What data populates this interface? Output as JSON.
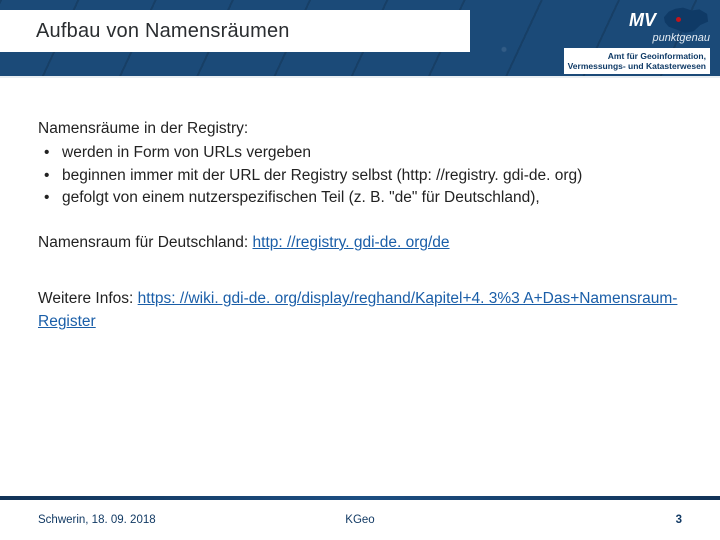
{
  "header": {
    "title": "Aufbau von Namensräumen",
    "brand_text": "MV",
    "brand_tagline": "punktgenau",
    "agency": "Amt für Geoinformation,\nVermessungs- und Katasterwesen"
  },
  "body": {
    "intro": "Namensräume in der Registry:",
    "bullets": [
      "werden in Form von URLs vergeben",
      "beginnen immer mit der URL der Registry selbst (http: //registry. gdi-de. org)",
      "gefolgt von einem nutzerspezifischen Teil (z. B. \"de\" für Deutschland),"
    ],
    "ns_label": "Namensraum für Deutschland:  ",
    "ns_link": "http: //registry. gdi-de. org/de",
    "info_label": "Weitere Infos:  ",
    "info_link": "https: //wiki. gdi-de. org/display/reghand/Kapitel+4. 3%3 A+Das+Namensraum-Register"
  },
  "footer": {
    "left": "Schwerin, 18. 09. 2018",
    "center": "KGeo",
    "page_number": "3"
  }
}
